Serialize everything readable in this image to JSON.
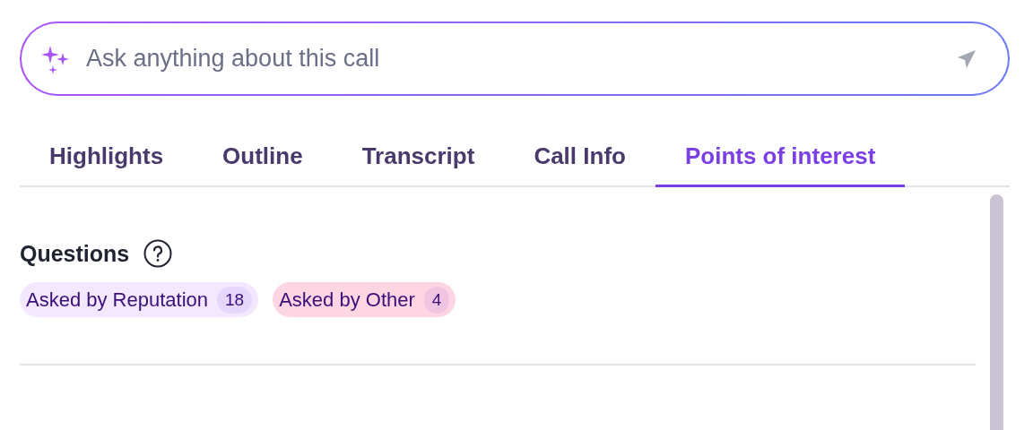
{
  "ask": {
    "placeholder": "Ask anything about this call"
  },
  "tabs": [
    {
      "label": "Highlights",
      "selected": false
    },
    {
      "label": "Outline",
      "selected": false
    },
    {
      "label": "Transcript",
      "selected": false
    },
    {
      "label": "Call Info",
      "selected": false
    },
    {
      "label": "Points of interest",
      "selected": true
    }
  ],
  "sections": [
    {
      "title": "Questions",
      "chips": [
        {
          "label": "Asked by Reputation",
          "count": "18",
          "color": "#f3e8ff"
        },
        {
          "label": "Asked by Other",
          "count": "4",
          "color": "#fdd5e3"
        }
      ]
    }
  ]
}
